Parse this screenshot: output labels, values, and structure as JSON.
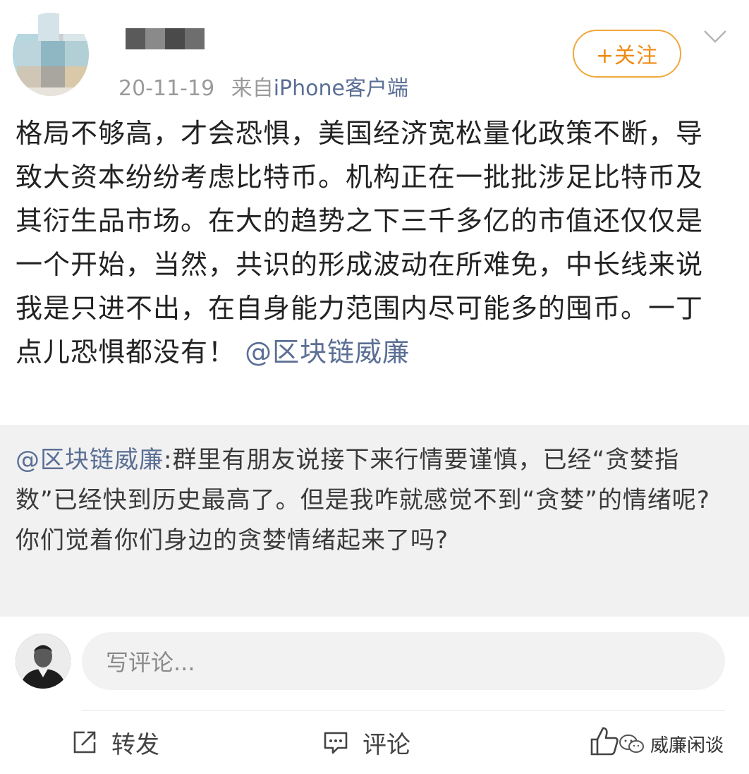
{
  "post": {
    "meta_date": "20-11-19",
    "meta_from": "来自",
    "meta_source": "iPhone客户端",
    "follow_label": "+关注",
    "text": "格局不够高，才会恐惧，美国经济宽松量化政策不断，导致大资本纷纷考虑比特币。机构正在一批批涉足比特币及其衍生品市场。在大的趋势之下三千多亿的市值还仅仅是一个开始，当然，共识的形成波动在所难免，中长线来说我是只进不出，在自身能力范围内尽可能多的囤币。一丁点儿恐惧都没有！",
    "mention": "@区块链威廉"
  },
  "repost": {
    "mention": "@区块链威廉",
    "text": ":群里有朋友说接下来行情要谨慎，已经“贪婪指数”已经快到历史最高了。但是我咋就感觉不到“贪婪”的情绪呢?",
    "text2": "你们觉着你们身边的贪婪情绪起来了吗?"
  },
  "comment_box": {
    "placeholder": "写评论..."
  },
  "actions": {
    "repost_label": "转发",
    "comment_label": "评论"
  },
  "watermark": {
    "text": "威廉闲谈"
  },
  "colors": {
    "follow": "#f08a13",
    "link": "#5b6f95",
    "repost_bg": "#f1f1f1"
  },
  "icons": [
    "chevron-down-icon",
    "share-icon",
    "comment-icon",
    "like-icon",
    "wechat-icon"
  ]
}
